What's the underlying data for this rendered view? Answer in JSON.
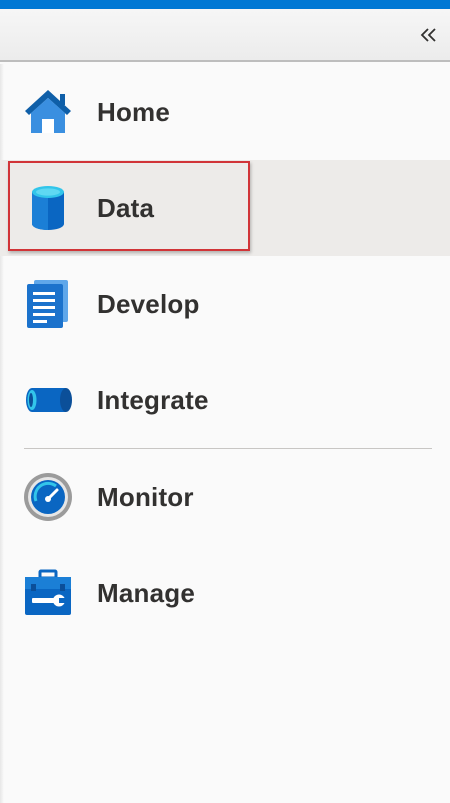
{
  "toolbar": {
    "collapse_icon": "double-chevron-left-icon"
  },
  "nav": {
    "items": [
      {
        "label": "Home",
        "icon": "home-icon"
      },
      {
        "label": "Data",
        "icon": "database-icon",
        "selected": true
      },
      {
        "label": "Develop",
        "icon": "document-icon"
      },
      {
        "label": "Integrate",
        "icon": "pipeline-icon"
      },
      {
        "label": "Monitor",
        "icon": "gauge-icon"
      },
      {
        "label": "Manage",
        "icon": "toolbox-icon"
      }
    ]
  },
  "colors": {
    "accent": "#0078d4",
    "selected_bg": "#edebe9",
    "highlight_border": "#d13438"
  }
}
